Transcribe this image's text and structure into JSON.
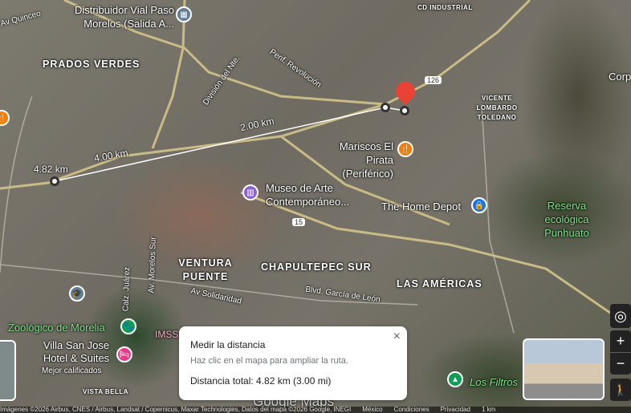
{
  "map": {
    "areas": [
      "PRADOS VERDES",
      "VENTURA PUENTE",
      "CHAPULTEPEC SUR",
      "LAS AMÉRICAS",
      "VISTA BELLA",
      "CD INDUSTRIAL"
    ],
    "neighborhood_vlt": "VICENTE LOMBARDO TOLEDANO",
    "roads": [
      "División del Nte.",
      "Perif. Revolución",
      "Av Solidaridad",
      "Blvd. García de León",
      "Av. Morelos Sur",
      "Calz. Juárez",
      "Av Quinceo"
    ],
    "road_shields": [
      "126",
      "15"
    ],
    "places": {
      "distribuidor": "Distribuidor Vial Paso Morelos (Salida A...",
      "mariscos": "Mariscos El Pirata (Periférico)",
      "museo": "Museo de Arte Contemporáneo...",
      "home_depot": "The Home Depot",
      "reserva": "Reserva ecológica Punhuato",
      "zoologico": "Zoológico de Morelia",
      "hotel": "Villa San Jose Hotel & Suites",
      "hotel_badge": "Mejor calificados",
      "imss": "IMSS",
      "filtros": "Los Filtros",
      "corp": "Corp"
    },
    "segments": [
      "4.82 km",
      "4.00 km",
      "2.00 km"
    ],
    "watermark": "Google Maps"
  },
  "measure": {
    "title": "Medir la distancia",
    "hint": "Haz clic en el mapa para ampliar la ruta.",
    "total": "Distancia total: 4.82 km (3.00 mi)",
    "close": "×"
  },
  "controls": {
    "locate": "◎",
    "zoom_in": "+",
    "zoom_out": "−",
    "pegman": "🚶"
  },
  "footer": {
    "attribution": "Imágenes ©2026 Airbus, CNES / Airbus, Landsat / Copernicus, Maxar Technologies, Datos del mapa ©2026 Google, INEGI",
    "country": "México",
    "terms": "Condiciones",
    "privacy": "Privacidad",
    "scale": "1 km"
  },
  "colors": {
    "pin": "#ea4335",
    "food": "#f57c00",
    "museum": "#8e63ce",
    "shop": "#1a73e8",
    "park": "#0f9d58",
    "hotel": "#e8388a",
    "edu": "#5f7d95"
  }
}
